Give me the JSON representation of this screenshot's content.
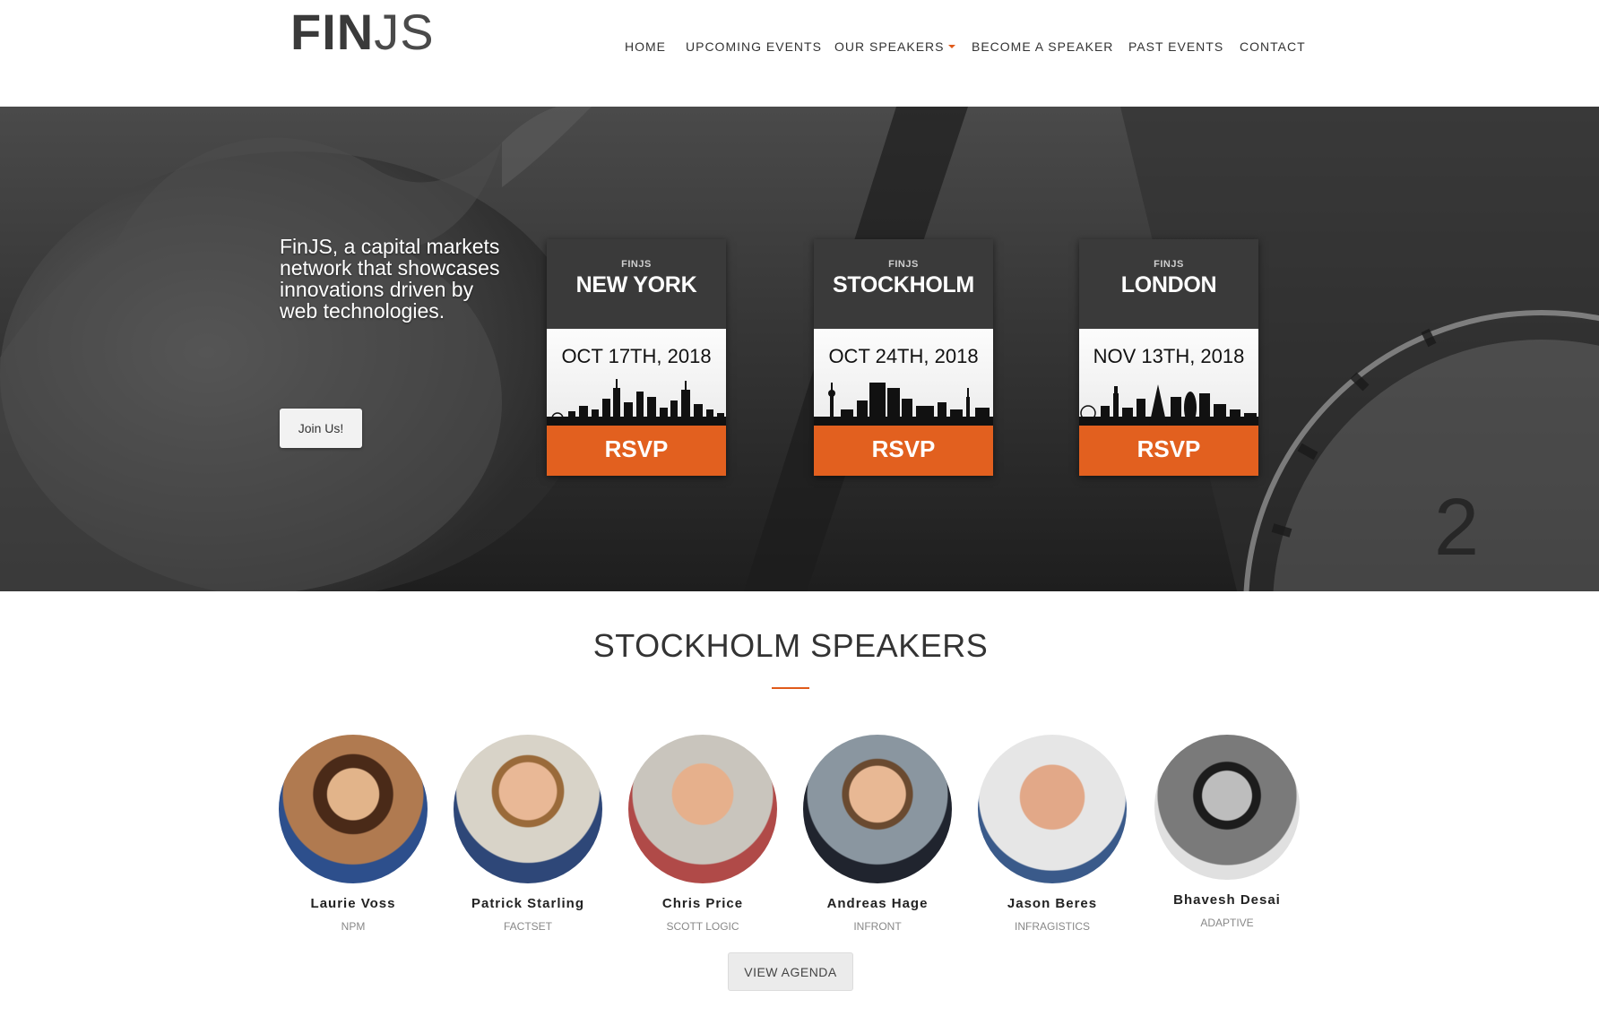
{
  "header": {
    "logo_bold": "FIN",
    "logo_light": "JS",
    "nav": [
      {
        "label": "HOME"
      },
      {
        "label": "UPCOMING EVENTS"
      },
      {
        "label": "OUR SPEAKERS",
        "has_dropdown": true
      },
      {
        "label": "BECOME A SPEAKER"
      },
      {
        "label": "PAST EVENTS"
      },
      {
        "label": "CONTACT"
      }
    ]
  },
  "hero": {
    "tagline": "FinJS, a capital markets network that showcases innovations driven by web technologies.",
    "join_label": "Join Us!",
    "events": [
      {
        "brand": "FINJS",
        "city": "NEW YORK",
        "date": "OCT 17TH, 2018",
        "cta": "RSVP"
      },
      {
        "brand": "FINJS",
        "city": "STOCKHOLM",
        "date": "OCT 24TH, 2018",
        "cta": "RSVP"
      },
      {
        "brand": "FINJS",
        "city": "LONDON",
        "date": "NOV 13TH, 2018",
        "cta": "RSVP"
      }
    ]
  },
  "speakers_section": {
    "title": "STOCKHOLM SPEAKERS",
    "speakers": [
      {
        "name": "Laurie Voss",
        "company": "NPM"
      },
      {
        "name": "Patrick Starling",
        "company": "FACTSET"
      },
      {
        "name": "Chris Price",
        "company": "SCOTT LOGIC"
      },
      {
        "name": "Andreas Hage",
        "company": "INFRONT"
      },
      {
        "name": "Jason Beres",
        "company": "INFRAGISTICS"
      },
      {
        "name": "Bhavesh Desai",
        "company": "ADAPTIVE"
      }
    ],
    "agenda_label": "VIEW AGENDA"
  },
  "colors": {
    "accent": "#e2601f",
    "card_top": "#3a3a3a",
    "hero_dark": "#2a2a2a"
  }
}
